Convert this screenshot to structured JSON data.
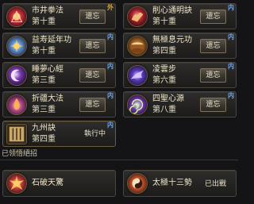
{
  "skills": [
    {
      "name": "市井拳法",
      "level": "第十重",
      "button": "遗忘",
      "tag": "外",
      "tag_color": "#d6a94c",
      "icon": "fist-icon"
    },
    {
      "name": "削心通明訣",
      "level": "第十重",
      "button": "遗忘",
      "tag": "内",
      "tag_color": "#6fa6e8",
      "icon": "phoenix-icon"
    },
    {
      "name": "益寿延年功",
      "level": "第十重",
      "button": "遗忘",
      "tag": "内",
      "tag_color": "#6fa6e8",
      "icon": "lotus-icon"
    },
    {
      "name": "無極息元功",
      "level": "第四重",
      "button": "遗忘",
      "tag": "内",
      "tag_color": "#6fa6e8",
      "icon": "drum-icon"
    },
    {
      "name": "睡夢心經",
      "level": "第三重",
      "button": "遗忘",
      "tag": "内",
      "tag_color": "#6fa6e8",
      "icon": "moon-icon"
    },
    {
      "name": "凌雲步",
      "level": "第六重",
      "button": "遗忘",
      "tag": "内",
      "tag_color": "#6fa6e8",
      "icon": "wing-icon"
    },
    {
      "name": "折疆大法",
      "level": "第三重",
      "button": "遗忘",
      "tag": "内",
      "tag_color": "#6fa6e8",
      "icon": "flame-icon"
    },
    {
      "name": "四聖心源",
      "level": "第八重",
      "button": "遗忘",
      "tag": "内",
      "tag_color": "#6fa6e8",
      "icon": "spiral-icon"
    },
    {
      "name": "九州訣",
      "level": "第四重",
      "status": "執行中",
      "tag": "内",
      "tag_color": "#6fa6e8",
      "icon": "scroll-icon"
    }
  ],
  "section_title": "已领悟絕招",
  "ultimates": [
    {
      "name": "石破天驚",
      "icon": "burst-icon"
    },
    {
      "name": "太極十三勢",
      "status": "已出戰",
      "icon": "taiji-icon"
    }
  ]
}
